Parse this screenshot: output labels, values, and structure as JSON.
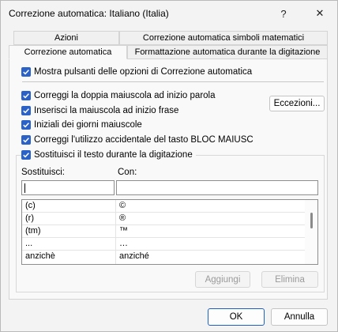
{
  "window": {
    "title": "Correzione automatica: Italiano (Italia)",
    "help_glyph": "?",
    "close_glyph": "✕"
  },
  "tabs": {
    "row1": [
      "Azioni",
      "Correzione automatica simboli matematici"
    ],
    "row2": [
      "Correzione automatica",
      "Formattazione automatica durante la digitazione"
    ],
    "active": "Correzione automatica"
  },
  "options": {
    "show_buttons": "Mostra pulsanti delle opzioni di Correzione automatica",
    "double_caps": "Correggi la doppia maiuscola ad inizio parola",
    "sentence_caps": "Inserisci la maiuscola ad inizio frase",
    "day_caps": "Iniziali dei giorni maiuscole",
    "caps_lock": "Correggi l'utilizzo accidentale del tasto BLOC MAIUSC",
    "replace_text": "Sostituisci il testo durante la digitazione"
  },
  "buttons": {
    "exceptions": "Eccezioni...",
    "add": "Aggiungi",
    "delete": "Elimina",
    "ok": "OK",
    "cancel": "Annulla"
  },
  "replace": {
    "replace_label": "Sostituisci:",
    "with_label": "Con:",
    "replace_value": "",
    "with_value": "",
    "entries": [
      {
        "from": "(c)",
        "to": "©"
      },
      {
        "from": "(r)",
        "to": "®"
      },
      {
        "from": "(tm)",
        "to": "™"
      },
      {
        "from": "...",
        "to": "…"
      },
      {
        "from": "anzichè",
        "to": "anziché"
      }
    ]
  },
  "colors": {
    "accent": "#2b62c8",
    "primary_border": "#1f5fc2"
  }
}
